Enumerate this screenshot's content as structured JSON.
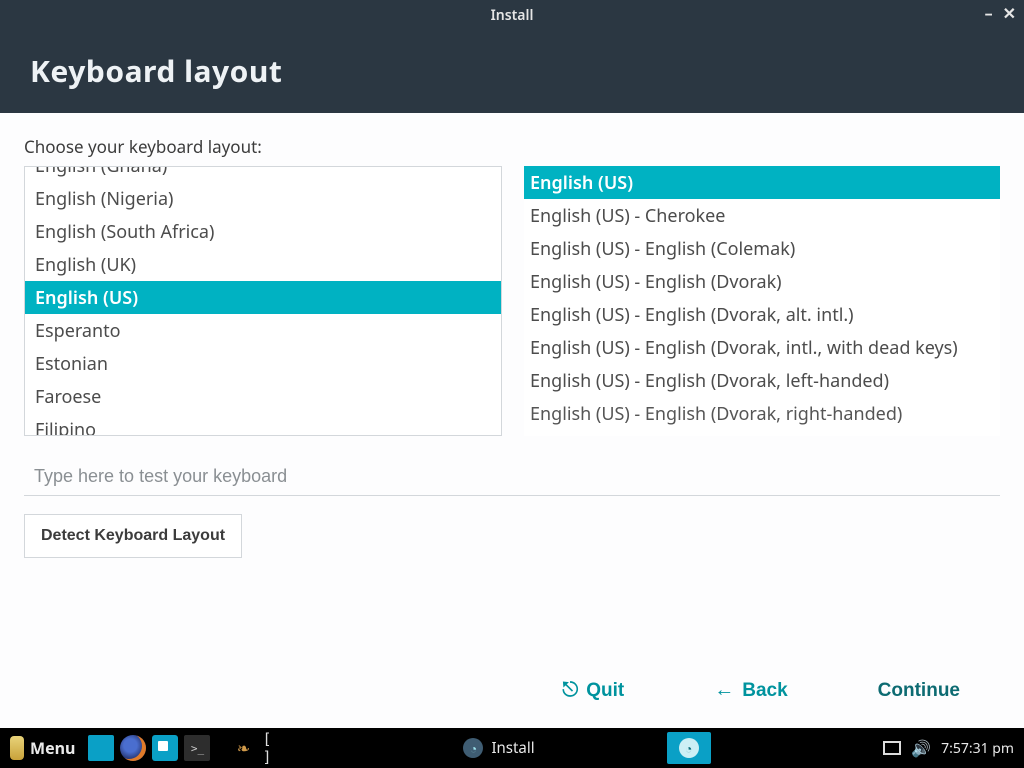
{
  "window": {
    "title": "Install",
    "heading": "Keyboard layout"
  },
  "prompt": "Choose your keyboard layout:",
  "layouts_left": [
    {
      "label": "English (Ghana)",
      "partial": true
    },
    {
      "label": "English (Nigeria)"
    },
    {
      "label": "English (South Africa)"
    },
    {
      "label": "English (UK)"
    },
    {
      "label": "English (US)",
      "selected": true
    },
    {
      "label": "Esperanto"
    },
    {
      "label": "Estonian"
    },
    {
      "label": "Faroese"
    },
    {
      "label": "Filipino",
      "partial_bottom": true
    }
  ],
  "layouts_right": [
    {
      "label": "English (US)",
      "selected": true
    },
    {
      "label": "English (US) - Cherokee"
    },
    {
      "label": "English (US) - English (Colemak)"
    },
    {
      "label": "English (US) - English (Dvorak)"
    },
    {
      "label": "English (US) - English (Dvorak, alt. intl.)"
    },
    {
      "label": "English (US) - English (Dvorak, intl., with dead keys)"
    },
    {
      "label": "English (US) - English (Dvorak, left-handed)"
    },
    {
      "label": "English (US) - English (Dvorak, right-handed)",
      "partial_bottom": true
    }
  ],
  "test_input": {
    "placeholder": "Type here to test your keyboard",
    "value": ""
  },
  "detect_button": "Detect Keyboard Layout",
  "nav": {
    "quit": "Quit",
    "back": "Back",
    "continue": "Continue"
  },
  "taskbar": {
    "menu": "Menu",
    "app_label": "Install",
    "clock": "7:57:31 pm"
  },
  "colors": {
    "accent": "#00b2c2",
    "teal_text": "#00939e"
  }
}
